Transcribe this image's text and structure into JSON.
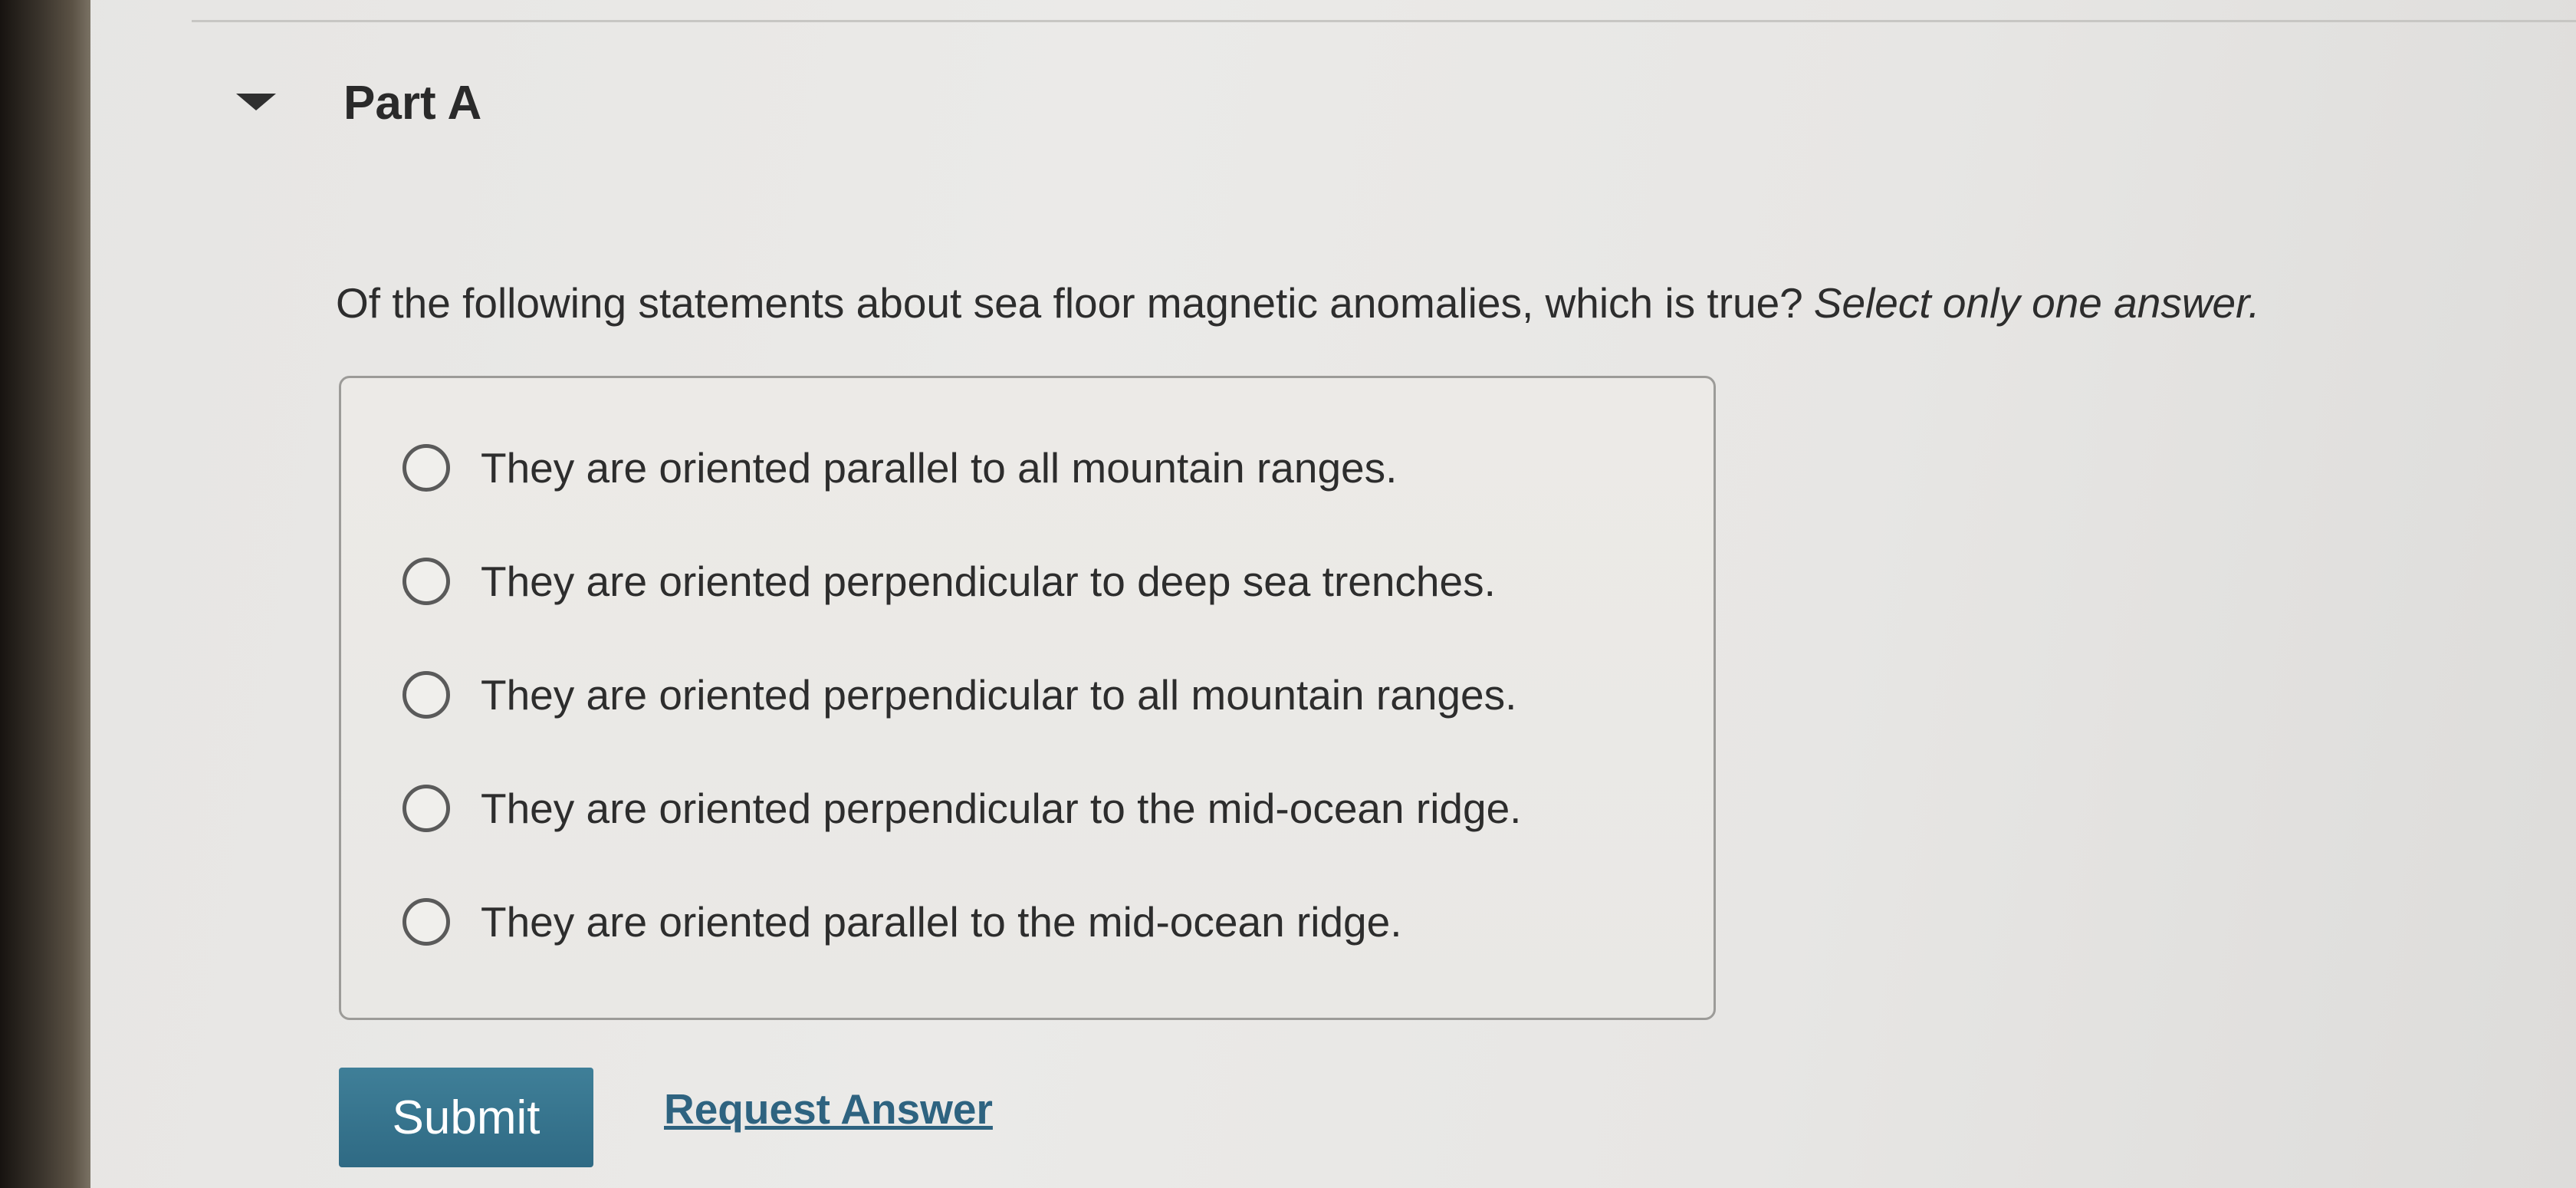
{
  "part": {
    "title": "Part A"
  },
  "question": {
    "text": "Of the following statements about sea floor magnetic anomalies, which is true?",
    "instruction": "Select only one answer."
  },
  "options": [
    {
      "label": "They are oriented parallel to all mountain ranges.",
      "selected": false
    },
    {
      "label": "They are oriented perpendicular to deep sea trenches.",
      "selected": false
    },
    {
      "label": "They are oriented perpendicular to all mountain ranges.",
      "selected": false
    },
    {
      "label": "They are oriented perpendicular to the mid-ocean ridge.",
      "selected": false
    },
    {
      "label": "They are oriented parallel to the mid-ocean ridge.",
      "selected": false
    }
  ],
  "actions": {
    "submit_label": "Submit",
    "request_answer_label": "Request Answer"
  },
  "colors": {
    "submit_button": "#2f6a84",
    "link": "#2e6380"
  }
}
